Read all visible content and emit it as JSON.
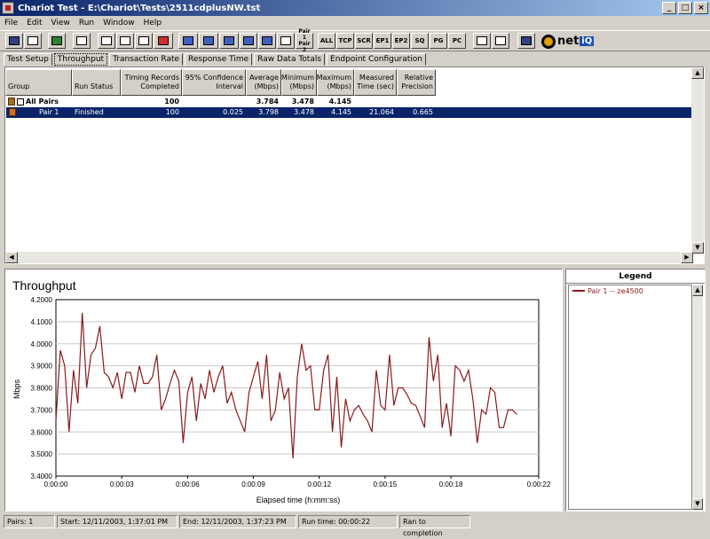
{
  "window": {
    "title": "Chariot Test - E:\\Chariot\\Tests\\2511cdplusNW.tst",
    "buttons": [
      "_",
      "□",
      "×"
    ]
  },
  "menu": [
    "File",
    "Edit",
    "View",
    "Run",
    "Window",
    "Help"
  ],
  "toolbar": {
    "text_buttons": [
      "ALL",
      "TCP",
      "SCR",
      "EP1",
      "EP2",
      "SQ",
      "PG",
      "PC"
    ],
    "pair_button": "Pair 1 Pair 2",
    "icons": [
      "save-icon",
      "print-icon",
      "run-icon",
      "stop-icon",
      "cut-icon",
      "copy-icon",
      "paste-icon",
      "delete-icon",
      "pair-icon",
      "multicast-icon",
      "network-icon",
      "edit-pair-icon",
      "app-group-icon",
      "script-icon",
      "grid-icon",
      "list-icon",
      "info-icon"
    ],
    "brand": "net",
    "brand_suffix": "iQ"
  },
  "tabs": [
    "Test Setup",
    "Throughput",
    "Transaction Rate",
    "Response Time",
    "Raw Data Totals",
    "Endpoint Configuration"
  ],
  "active_tab": "Throughput",
  "table": {
    "headers": [
      "Group",
      "Run Status",
      "Timing Records Completed",
      "95% Confidence Interval",
      "Average (Mbps)",
      "Minimum (Mbps)",
      "Maximum (Mbps)",
      "Measured Time (sec)",
      "Relative Precision"
    ],
    "rows": [
      {
        "group": "All Pairs",
        "status": "",
        "records": "100",
        "confidence": "",
        "average": "3.784",
        "minimum": "3.478",
        "maximum": "4.145",
        "time": "",
        "precision": ""
      },
      {
        "group": "Pair 1",
        "status": "Finished",
        "records": "100",
        "confidence": "0.025",
        "average": "3.798",
        "minimum": "3.478",
        "maximum": "4.145",
        "time": "21.064",
        "precision": "0.665"
      }
    ]
  },
  "legend": {
    "title": "Legend",
    "items": [
      "Pair 1 -- ze4500"
    ]
  },
  "chart_data": {
    "type": "line",
    "title": "Throughput",
    "xlabel": "Elapsed time (h:mm:ss)",
    "ylabel": "Mbps",
    "ylim": [
      3.4,
      4.2
    ],
    "xlim_seconds": [
      0,
      22
    ],
    "x_ticks": [
      "0:00:00",
      "0:00:03",
      "0:00:06",
      "0:00:09",
      "0:00:12",
      "0:00:15",
      "0:00:18",
      "0:00:22"
    ],
    "y_ticks": [
      "4.2000",
      "4.1000",
      "4.0000",
      "3.9000",
      "3.8000",
      "3.7000",
      "3.6000",
      "3.5000",
      "3.4000"
    ],
    "grid": "horizontal",
    "series": [
      {
        "name": "Pair 1 -- ze4500",
        "color": "#8b1a1a",
        "x": [
          0.0,
          0.2,
          0.4,
          0.6,
          0.8,
          1.0,
          1.2,
          1.4,
          1.6,
          1.8,
          2.0,
          2.2,
          2.4,
          2.6,
          2.8,
          3.0,
          3.2,
          3.4,
          3.6,
          3.8,
          4.0,
          4.2,
          4.4,
          4.6,
          4.8,
          5.0,
          5.2,
          5.4,
          5.6,
          5.8,
          6.0,
          6.2,
          6.4,
          6.6,
          6.8,
          7.0,
          7.2,
          7.4,
          7.6,
          7.8,
          8.0,
          8.2,
          8.4,
          8.6,
          8.8,
          9.0,
          9.2,
          9.4,
          9.6,
          9.8,
          10.0,
          10.2,
          10.4,
          10.6,
          10.8,
          11.0,
          11.2,
          11.4,
          11.6,
          11.8,
          12.0,
          12.2,
          12.4,
          12.6,
          12.8,
          13.0,
          13.2,
          13.4,
          13.6,
          13.8,
          14.0,
          14.2,
          14.4,
          14.6,
          14.8,
          15.0,
          15.2,
          15.4,
          15.6,
          15.8,
          16.0,
          16.2,
          16.4,
          16.6,
          16.8,
          17.0,
          17.2,
          17.4,
          17.6,
          17.8,
          18.0,
          18.2,
          18.4,
          18.6,
          18.8,
          19.0,
          19.2,
          19.4,
          19.6,
          19.8,
          20.0,
          20.2,
          20.4,
          20.6,
          20.8,
          21.0
        ],
        "values": [
          3.65,
          3.97,
          3.9,
          3.6,
          3.88,
          3.73,
          4.14,
          3.8,
          3.95,
          3.98,
          4.08,
          3.87,
          3.85,
          3.8,
          3.87,
          3.75,
          3.87,
          3.87,
          3.78,
          3.9,
          3.82,
          3.82,
          3.85,
          3.95,
          3.7,
          3.75,
          3.82,
          3.88,
          3.83,
          3.55,
          3.78,
          3.85,
          3.65,
          3.82,
          3.75,
          3.88,
          3.78,
          3.85,
          3.9,
          3.73,
          3.78,
          3.7,
          3.65,
          3.6,
          3.78,
          3.85,
          3.92,
          3.75,
          3.95,
          3.65,
          3.7,
          3.87,
          3.75,
          3.8,
          3.48,
          3.85,
          4.0,
          3.88,
          3.9,
          3.7,
          3.7,
          3.88,
          3.95,
          3.6,
          3.85,
          3.53,
          3.75,
          3.65,
          3.7,
          3.72,
          3.68,
          3.65,
          3.6,
          3.88,
          3.72,
          3.7,
          3.95,
          3.72,
          3.8,
          3.8,
          3.77,
          3.73,
          3.72,
          3.67,
          3.62,
          4.03,
          3.83,
          3.95,
          3.62,
          3.73,
          3.58,
          3.9,
          3.88,
          3.83,
          3.88,
          3.75,
          3.55,
          3.7,
          3.68,
          3.8,
          3.78,
          3.62,
          3.62,
          3.7,
          3.7,
          3.68
        ]
      }
    ]
  },
  "statusbar": {
    "pairs": "Pairs: 1",
    "start": "Start: 12/11/2003, 1:37:01 PM",
    "end": "End: 12/11/2003, 1:37:23 PM",
    "runtime": "Run time: 00:00:22",
    "status": "Ran to completion"
  }
}
